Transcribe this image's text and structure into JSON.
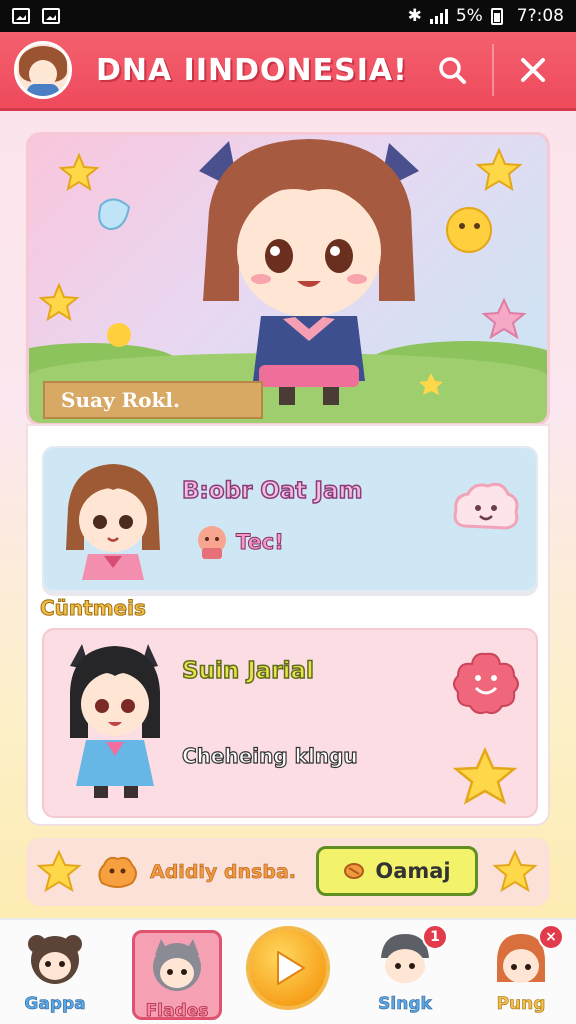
{
  "status_bar": {
    "battery": "5%",
    "time": "7?:08"
  },
  "header": {
    "title": "DNA IINDONESIA!",
    "search_icon": "search-icon",
    "close_icon": "close-icon"
  },
  "hero": {
    "name_tag": "Suay Rokl."
  },
  "cards": [
    {
      "title": "B:obr Oat Jam",
      "tag": "Tec!"
    },
    {
      "title": "Suin Jarial",
      "subtitle": "Cheheing klngu"
    }
  ],
  "section_label": "Cüntmeis",
  "action_bar": {
    "text": "Adidiy dnsba.",
    "button_label": "Oamaj"
  },
  "bottom_nav": [
    {
      "label": "Gappa"
    },
    {
      "label": "Flades",
      "active": true
    },
    {
      "label": "Singk",
      "badge": "1"
    },
    {
      "label": "Pung",
      "badge": "×"
    }
  ],
  "colors": {
    "header": "#ee4a5c",
    "accent_yellow": "#f7a21c",
    "card_blue": "#cfe7f4",
    "card_pink": "#fbdde3"
  }
}
